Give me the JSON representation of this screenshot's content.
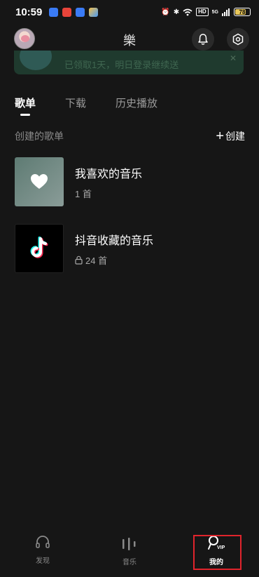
{
  "status_bar": {
    "time": "10:59",
    "hd_badge": "HD",
    "network": "5G",
    "battery": "78",
    "battery_level": 0.78
  },
  "header": {
    "title": "樂"
  },
  "banner": {
    "text": "已领取1天，明日登录继续送"
  },
  "tabs": [
    {
      "label": "歌单",
      "active": true
    },
    {
      "label": "下载",
      "active": false
    },
    {
      "label": "历史播放",
      "active": false
    }
  ],
  "section": {
    "title": "创建的歌单",
    "create_label": "创建"
  },
  "playlists": [
    {
      "name": "我喜欢的音乐",
      "count": "1 首",
      "icon": "heart-icon"
    },
    {
      "name": "抖音收藏的音乐",
      "count": "24 首",
      "icon": "tiktok-icon",
      "locked": true
    }
  ],
  "bottom_nav": [
    {
      "label": "发现",
      "icon": "headphones-icon"
    },
    {
      "label": "音乐",
      "icon": "equalizer-icon"
    },
    {
      "label": "我的",
      "icon": "vip-user-icon",
      "active": true
    }
  ],
  "colors": {
    "background": "#161616",
    "banner": "#1f3a2e",
    "highlight": "#e0242c"
  }
}
